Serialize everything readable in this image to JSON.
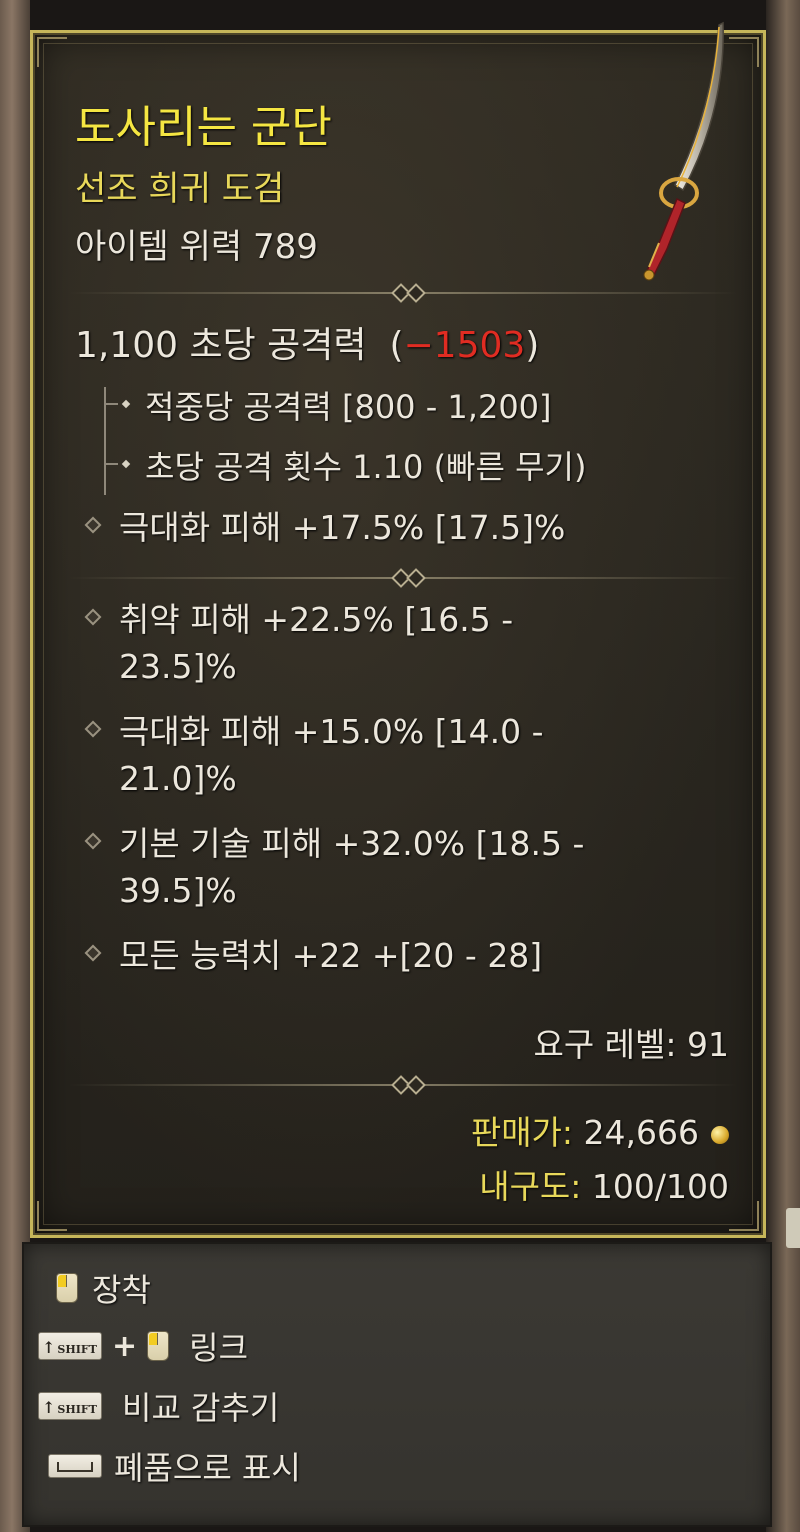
{
  "item": {
    "name": "도사리는 군단",
    "type": "선조 희귀 도검",
    "power": "아이템 위력 789"
  },
  "dps": {
    "value": "1,100 초당 공격력",
    "diff_open": "(",
    "diff": "−1503",
    "diff_close": ")"
  },
  "base_stats": [
    "적중당 공격력 [800 - 1,200]",
    "초당 공격 횟수 1.10 (빠른 무기)",
    "극대화 피해 +17.5% [17.5]%"
  ],
  "affixes": [
    {
      "line1": "취약 피해 +22.5% [16.5 -",
      "line2": "23.5]%"
    },
    {
      "line1": "극대화 피해 +15.0% [14.0 -",
      "line2": "21.0]%"
    },
    {
      "line1": "기본 기술 피해 +32.0% [18.5 -",
      "line2": "39.5]%"
    },
    {
      "line1": "모든 능력치 +22 +[20 - 28]",
      "line2": ""
    }
  ],
  "requirements": {
    "level": "요구 레벨: 91"
  },
  "footer": {
    "sell_label": "판매가:",
    "sell_value": "24,666",
    "durability_label": "내구도:",
    "durability_value": "100/100"
  },
  "controls": {
    "equip": "장착",
    "shift_key": "SHIFT",
    "plus": "+",
    "link": "링크",
    "hide_compare": "비교 감추기",
    "mark_junk": "폐품으로 표시"
  },
  "colors": {
    "title": "#f5e642",
    "rarity": "#e8d85a",
    "negative": "#e02c22",
    "text": "#ece7dc"
  },
  "icons": [
    "sword-icon",
    "gold-coin-icon",
    "mouse-left-icon",
    "shift-key-icon",
    "space-key-icon"
  ]
}
